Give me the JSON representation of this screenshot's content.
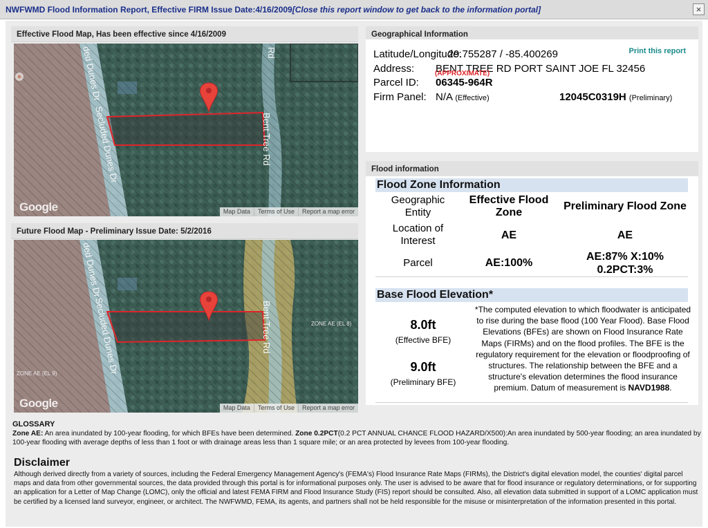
{
  "window": {
    "title": "NWFWMD Flood Information Report, Effective FIRM Issue Date:4/16/2009",
    "title_link": "[Close this report window to get back to the information portal]",
    "close_glyph": "×"
  },
  "effective_map": {
    "header": "Effective Flood Map, Has been effective since 4/16/2009",
    "street_label_1": "Secluded Dunes Dr",
    "street_label_2": "Bent Tree Rd",
    "street_label_top_left": "ded Dunes Dr",
    "street_label_top_right": "Rd",
    "google_logo": "Google",
    "attribution": [
      "Map Data",
      "Terms of Use",
      "Report a map error"
    ]
  },
  "future_map": {
    "header": "Future Flood Map - Preliminary Issue Date: 5/2/2016",
    "street_label_1": "Secluded Dunes Dr",
    "street_label_2": "Bent Tree Rd",
    "street_label_top_left": "ded Dunes Dr",
    "zone_label_right": "ZONE AE (EL 8)",
    "zone_label_left": "ZONE AE (EL 9)",
    "google_logo": "Google",
    "attribution": [
      "Map Data",
      "Terms of Use",
      "Report a map error"
    ]
  },
  "geo": {
    "header": "Geographical Information",
    "print_link": "Print this report",
    "latlon_label": "Latitude/Longitude:",
    "latlon_value": "29.755287 / -85.400269",
    "address_label": "Address:",
    "address_value": "BENT TREE RD PORT SAINT JOE FL 32456",
    "parcel_label": "Parcel ID:",
    "parcel_value": "06345-964R",
    "approximate": "(APPROXIMATE)",
    "firm_label": "Firm Panel:",
    "firm_effective_value": "N/A",
    "firm_effective_tag": "(Effective)",
    "firm_prelim_value": "12045C0319H",
    "firm_prelim_tag": "(Preliminary)"
  },
  "flood": {
    "header": "Flood information",
    "zone_title": "Flood Zone Information",
    "col_geo": "Geographic Entity",
    "col_effective": "Effective Flood Zone",
    "col_prelim": "Preliminary Flood Zone",
    "row1_label": "Location of Interest",
    "row1_effective": "AE",
    "row1_prelim": "AE",
    "row2_label": "Parcel",
    "row2_effective": "AE:100%",
    "row2_prelim_line1": "AE:87% X:10%",
    "row2_prelim_line2": "0.2PCT:3%",
    "bfe_title": "Base Flood Elevation*",
    "bfe_effective_value": "8.0ft",
    "bfe_effective_label": "(Effective BFE)",
    "bfe_prelim_value": "9.0ft",
    "bfe_prelim_label": "(Preliminary BFE)",
    "bfe_note": "*The computed elevation to which floodwater is anticipated to rise during the base flood (100 Year Flood). Base Flood Elevations (BFEs) are shown on Flood Insurance Rate Maps (FIRMs) and on the flood profiles. The BFE is the regulatory requirement for the elevation or floodproofing of structures. The relationship between the BFE and a structure's elevation determines the flood insurance premium. Datum of measurement is",
    "bfe_datum": "NAVD1988",
    "bfe_note_end": "."
  },
  "glossary": {
    "title": "GLOSSARY",
    "ae_term": "Zone AE:",
    "ae_text": " An area inundated by 100-year flooding, for which BFEs have been determined. ",
    "pct_term": "Zone 0.2PCT",
    "pct_text": "(0.2 PCT ANNUAL CHANCE FLOOD HAZARD/X500):An area inundated by 500-year flooding; an area inundated by 100-year flooding with average depths of less than 1 foot or with drainage areas less than 1 square mile; or an area protected by levees from 100-year flooding."
  },
  "disclaimer": {
    "title": "Disclaimer",
    "text": "Although derived directly from a variety of sources, including the Federal Emergency Management Agency's (FEMA's) Flood Insurance Rate Maps (FIRMs), the District's digital elevation model, the counties' digital parcel maps and data from other governmental sources, the data provided through this portal is for informational purposes only. The user is advised to be aware that for flood insurance or regulatory determinations, or for supporting an application for a Letter of Map Change (LOMC), only the official and latest FEMA FIRM and Flood Insurance Study (FIS) report should be consulted. Also, all elevation data submitted in support of a LOMC application must be certified by a licensed land surveyor, engineer, or architect. The NWFWMD, FEMA, its agents, and partners shall not be held responsible for the misuse or misinterpretation of the information presented in this portal."
  },
  "colors": {
    "title_text": "#1a2e8a",
    "parcel_outline": "#e0242a",
    "pin": "#e8433a",
    "zone_band": "#d7e2f0",
    "print_link": "#1a8a8a"
  }
}
